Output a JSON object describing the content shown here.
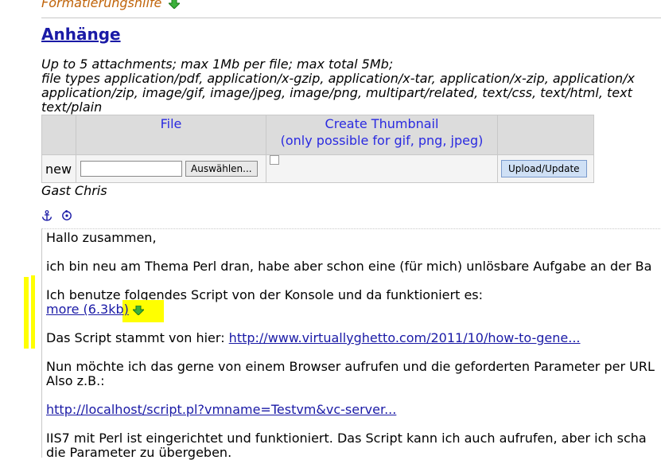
{
  "format_help": {
    "label": "Formatierungshilfe",
    "icon": "green-down-arrow-icon"
  },
  "attachments": {
    "heading": "Anhänge",
    "info_lines": [
      "Up to 5 attachments; max 1Mb per file; max total 5Mb;",
      "file types application/pdf, application/x-gzip, application/x-tar, application/x-zip, application/x",
      "application/zip, image/gif, image/jpeg, image/png, multipart/related, text/css, text/html, text",
      "text/plain"
    ],
    "table": {
      "col_file": "File",
      "col_thumb_1": "Create Thumbnail",
      "col_thumb_2": "(only possible for gif, png, jpeg)",
      "new_label": "new",
      "browse_label": "Auswählen...",
      "upload_label": "Upload/Update"
    }
  },
  "author": "Gast Chris",
  "post": {
    "greeting": "Hallo zusammen,",
    "line1": "ich bin neu am Thema Perl dran, habe aber schon eine (für mich) unlösbare Aufgabe an der Ba",
    "line2": "Ich benutze folgendes Script von der Konsole und da funktioniert es:",
    "more_link": "more (6.3kb)",
    "source_prefix": "Das Script stammt von hier: ",
    "source_link": "http://www.virtuallyghetto.com/2011/10/how-to-gene...",
    "line3a": "Nun möchte ich das gerne von einem Browser aufrufen und die geforderten Parameter per URL",
    "line3b": "Also z.B.:",
    "example_link": "http://localhost/script.pl?vmname=Testvm&vc-server...",
    "line4a": "IIS7 mit Perl ist eingerichtet und funktioniert. Das Script kann ich auch aufrufen, aber ich scha",
    "line4b": "die Parameter zu übergeben."
  },
  "colors": {
    "link": "#1a1aa6",
    "header_bg": "#dcdcdc",
    "header_text": "#2a2ae0",
    "highlight": "#ffff00"
  }
}
